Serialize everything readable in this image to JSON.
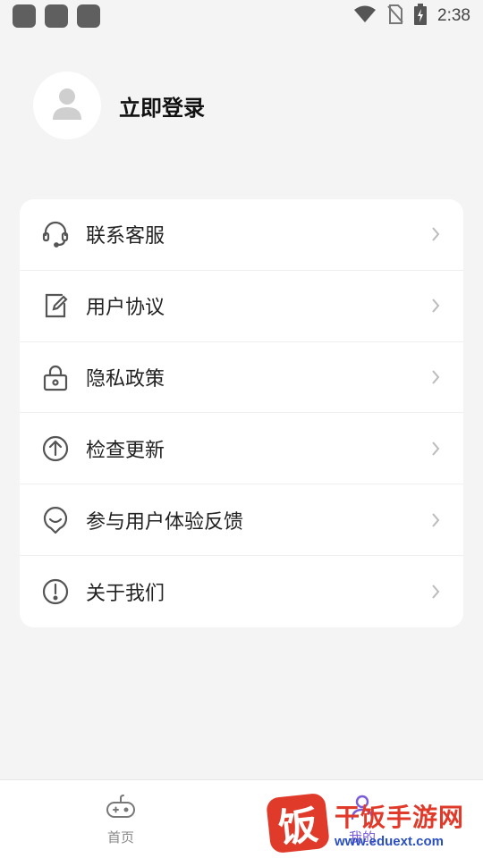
{
  "status_bar": {
    "time": "2:38",
    "icons": [
      "app-square-icon",
      "app-square-icon",
      "app-square-icon",
      "wifi-icon",
      "no-sim-icon",
      "battery-charging-icon"
    ]
  },
  "profile": {
    "login_label": "立即登录",
    "avatar_icon": "user-icon"
  },
  "menu": {
    "items": [
      {
        "label": "联系客服",
        "icon": "headset-icon"
      },
      {
        "label": "用户协议",
        "icon": "document-edit-icon"
      },
      {
        "label": "隐私政策",
        "icon": "lock-icon"
      },
      {
        "label": "检查更新",
        "icon": "arrow-up-circle-icon"
      },
      {
        "label": "参与用户体验反馈",
        "icon": "feedback-smile-icon"
      },
      {
        "label": "关于我们",
        "icon": "info-exclamation-icon"
      }
    ]
  },
  "bottom_nav": {
    "tabs": [
      {
        "label": "首页",
        "icon": "gamepad-icon"
      },
      {
        "label": "我的",
        "icon": "person-icon"
      }
    ]
  },
  "watermark": {
    "logo_char": "饭",
    "title": "干饭手游网",
    "url": "www.eduext.com"
  },
  "colors": {
    "background": "#f4f4f4",
    "card": "#ffffff",
    "active_tab": "#7a5cd6",
    "watermark_red": "#e03a2a",
    "watermark_blue": "#2a4fbf"
  }
}
